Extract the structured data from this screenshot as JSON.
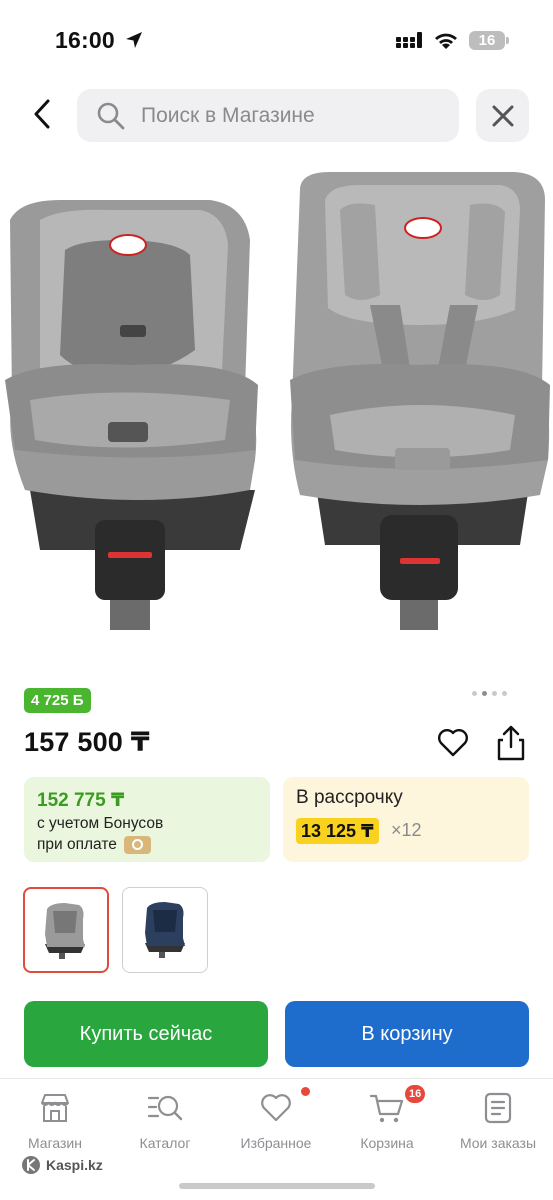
{
  "status_bar": {
    "time": "16:00",
    "battery": "16"
  },
  "header": {
    "search_placeholder": "Поиск в Магазине"
  },
  "product": {
    "bonus_badge": "4 725 Б",
    "price": "157 500 ₸",
    "gallery_dots": 4,
    "gallery_active_index": 0,
    "bonus_card": {
      "amount": "152 775 ₸",
      "line1": "с учетом Бонусов",
      "line2": "при оплате"
    },
    "installment_card": {
      "title": "В рассрочку",
      "monthly": "13 125 ₸",
      "months": "×12"
    },
    "variants": [
      {
        "color": "grey",
        "selected": true
      },
      {
        "color": "blue",
        "selected": false
      }
    ]
  },
  "actions": {
    "buy_now": "Купить сейчас",
    "add_to_cart": "В корзину"
  },
  "tabbar": {
    "items": [
      {
        "label": "Магазин",
        "icon": "shop-icon"
      },
      {
        "label": "Каталог",
        "icon": "catalog-icon"
      },
      {
        "label": "Избранное",
        "icon": "heart-icon"
      },
      {
        "label": "Корзина",
        "icon": "cart-icon",
        "badge": "16"
      },
      {
        "label": "Мои заказы",
        "icon": "orders-icon"
      }
    ]
  },
  "brand": "Kaspi.kz",
  "colors": {
    "accent_green": "#2aa63f",
    "accent_blue": "#1e6ccc",
    "bonus_green": "#4ab52e",
    "installment_yellow": "#f8d21f",
    "badge_red": "#e8483b"
  }
}
